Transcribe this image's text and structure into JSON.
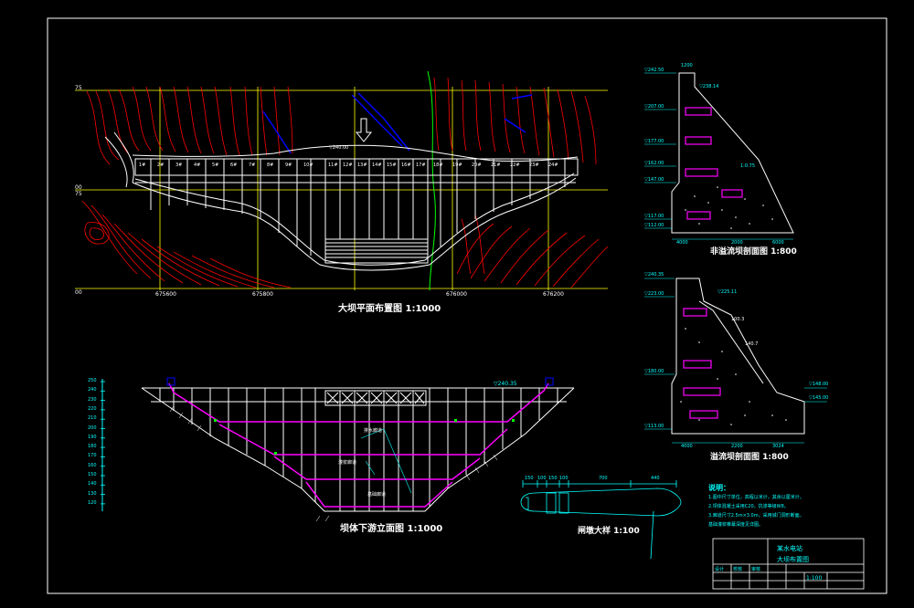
{
  "titles": {
    "plan": "大坝平面布置图 1:1000",
    "elevation": "坝体下游立面图 1:1000",
    "section_nonoverflow": "非溢流坝剖面图 1:800",
    "section_overflow": "溢流坝剖面图 1:800",
    "gate_pier": "闸墩大样 1:100"
  },
  "elevation_scale": [
    "250",
    "240",
    "230",
    "220",
    "210",
    "200",
    "190",
    "180",
    "170",
    "160",
    "150",
    "140",
    "130",
    "120"
  ],
  "dam_blocks_left": [
    "1#",
    "2#",
    "3#",
    "4#",
    "5#",
    "6#",
    "7#",
    "8#",
    "9#",
    "10#"
  ],
  "dam_blocks_mid": [
    "11#",
    "12#",
    "13#",
    "14#",
    "15#",
    "16#",
    "17#"
  ],
  "dam_blocks_right": [
    "18#",
    "19#",
    "20#",
    "21#",
    "22#",
    "23#",
    "24#"
  ],
  "plan_labels": {
    "crest_elev": "▽240.00",
    "coord_1": "675600",
    "coord_2": "675800",
    "coord_3": "676000",
    "coord_4": "676200",
    "grid_y1": "75",
    "grid_y2": "00",
    "grid_y3": "75",
    "grid_y4": "00"
  },
  "elevation_labels": {
    "crest": "▽240.35",
    "gallery_1": "排水廊道",
    "gallery_2": "灌浆廊道",
    "gallery_3": "基础廊道"
  },
  "section_nonoverflow": {
    "crest_width": "1200",
    "el_top": "▽242.50",
    "el_a": "▽238.14",
    "el_b": "▽207.00",
    "el_c": "▽177.00",
    "el_d": "▽162.00",
    "el_e": "▽147.00",
    "el_f": "▽117.00",
    "el_g": "▽112.00",
    "dim_1": "4000",
    "dim_2": "2000",
    "dim_3": "6000",
    "slope": "1:0.75"
  },
  "section_overflow": {
    "el_top": "▽240.35",
    "el_a": "▽223.00",
    "el_b": "▽225.11",
    "el_c": "▽180.00",
    "el_d": "▽148.00",
    "el_e": "▽145.00",
    "el_f": "▽113.00",
    "dim_1": "4000",
    "dim_2": "2200",
    "dim_3": "3024",
    "len_1": "100.3",
    "len_2": "140.7"
  },
  "gate_pier": {
    "dims": [
      "150",
      "100",
      "150",
      "100",
      "700",
      "440"
    ]
  },
  "notes": {
    "heading": "说明：",
    "lines": [
      "1.图中尺寸单位，高程以米计，其余以厘米计。",
      "2.坝体混凝土采用C20，抗渗等级W8。",
      "3.廊道尺寸2.5m×3.0m，采用城门洞形断面。",
      "   基础灌浆帷幕深度见详图。"
    ]
  },
  "title_block": {
    "project": "某水电站",
    "drawing": "大坝布置图",
    "scale": "1:100",
    "r1": "设计",
    "r2": "校核",
    "r3": "审核"
  },
  "colors": {
    "terrain": "#ff0000",
    "dam": "#ffffff",
    "dimension": "#00ffff",
    "grid": "#ffff00",
    "gallery": "#ff00ff",
    "river": "#0000ff",
    "boundary": "#00ff00"
  }
}
